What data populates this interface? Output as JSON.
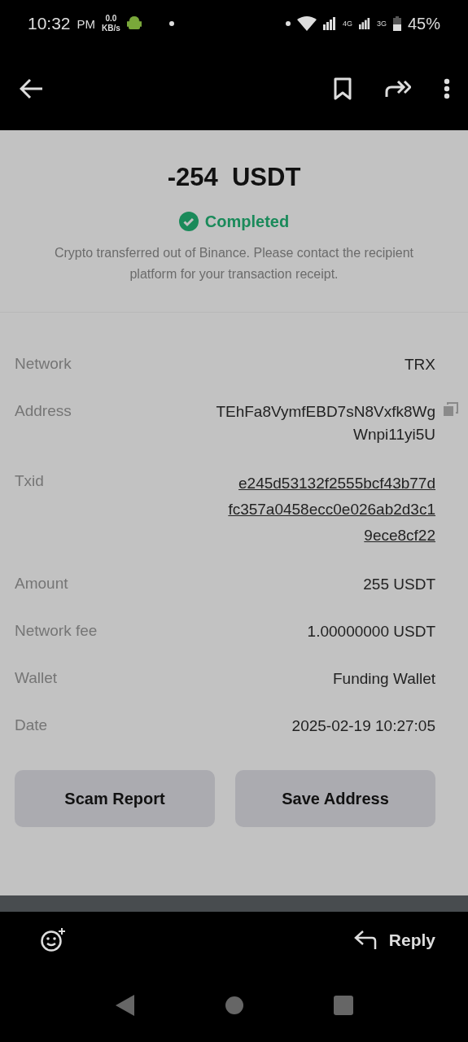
{
  "status_bar": {
    "time": "10:32",
    "ampm": "PM",
    "speed": "0.0",
    "speed_unit": "KB/s",
    "network_1": "4G",
    "network_2": "3G",
    "battery": "45%"
  },
  "transaction": {
    "amount": "-254  USDT",
    "status": "Completed",
    "note": "Crypto transferred out of Binance. Please contact the recipient platform for your transaction receipt."
  },
  "details": [
    {
      "label": "Network",
      "kind": "text",
      "lines": [
        "TRX"
      ]
    },
    {
      "label": "Address",
      "kind": "copyable",
      "lines": [
        "TEhFa8VymfEBD7sN8Vxfk8Wg",
        "Wnpi11yi5U"
      ]
    },
    {
      "label": "Txid",
      "kind": "link",
      "lines": [
        "e245d53132f2555bcf43b77d",
        "fc357a0458ecc0e026ab2d3c1",
        "9ece8cf22"
      ]
    },
    {
      "label": "Amount",
      "kind": "text",
      "lines": [
        "255  USDT"
      ]
    },
    {
      "label": "Network fee",
      "kind": "text",
      "lines": [
        "1.00000000 USDT"
      ]
    },
    {
      "label": "Wallet",
      "kind": "text",
      "lines": [
        "Funding Wallet"
      ]
    },
    {
      "label": "Date",
      "kind": "text",
      "lines": [
        "2025-02-19  10:27:05"
      ]
    }
  ],
  "buttons": [
    "Scam Report",
    "Save Address"
  ],
  "reply_bar": {
    "reply": "Reply"
  }
}
